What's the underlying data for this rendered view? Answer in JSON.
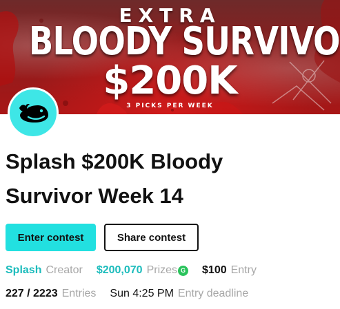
{
  "banner": {
    "extra": "EXTRA",
    "title": "BLOODY SURVIVOR",
    "prize": "$200K",
    "subtitle": "3 PICKS PER WEEK",
    "colors": {
      "base": "#a81616",
      "text": "#ffffff"
    }
  },
  "avatar": {
    "icon": "whale-icon",
    "color": "#3ee6e6"
  },
  "contest": {
    "title": "Splash $200K Bloody Survivor Week 14"
  },
  "actions": {
    "enter_label": "Enter contest",
    "share_label": "Share contest",
    "accent": "#22e0e0"
  },
  "stats": {
    "creator": {
      "value": "Splash",
      "label": "Creator"
    },
    "prizes": {
      "value": "$200,070",
      "label": "Prizes",
      "badge": "G"
    },
    "entry": {
      "value": "$100",
      "label": "Entry"
    },
    "entries": {
      "value": "227 / 2223",
      "label": "Entries"
    },
    "deadline": {
      "value": "Sun 4:25 PM",
      "label": "Entry deadline"
    }
  }
}
